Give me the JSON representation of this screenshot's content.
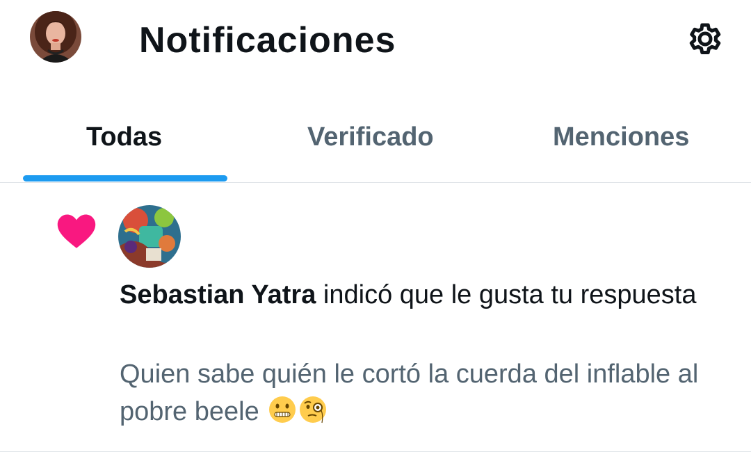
{
  "header": {
    "title": "Notificaciones",
    "profile_avatar": "profile-avatar",
    "settings_icon": "gear-icon"
  },
  "tabs": [
    {
      "label": "Todas",
      "active": true
    },
    {
      "label": "Verificado",
      "active": false
    },
    {
      "label": "Menciones",
      "active": false
    }
  ],
  "notification": {
    "type_icon": "heart-icon",
    "user_name": "Sebastian Yatra",
    "action_text": " indicó que le gusta tu respuesta",
    "reply_text": "Quien sabe quién le cortó la cuerda del inflable al pobre beele",
    "emojis": [
      "zipper-mouth-face-emoji",
      "face-with-monocle-emoji"
    ]
  },
  "colors": {
    "accent": "#1d9bf0",
    "like": "#f91880",
    "text_primary": "#0f1419",
    "text_secondary": "#536471",
    "divider": "#dfe4e8"
  }
}
